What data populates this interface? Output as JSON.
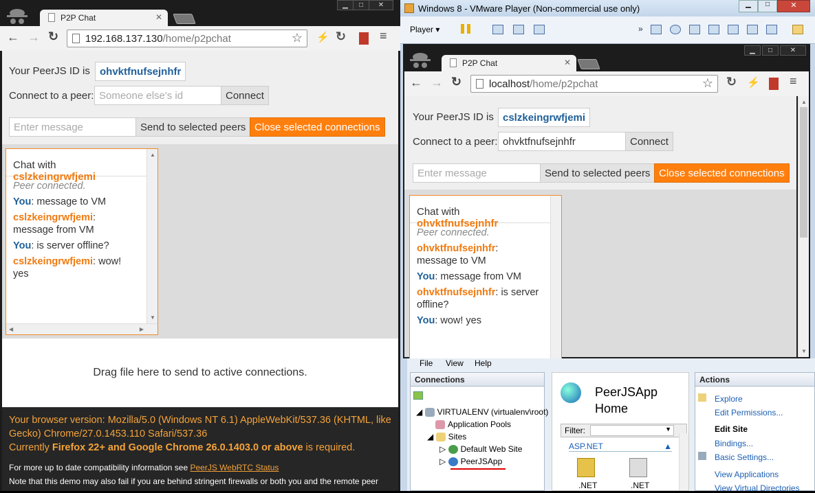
{
  "left_browser": {
    "tab_title": "P2P Chat",
    "url_host": "192.168.137.130",
    "url_path": "/home/p2pchat",
    "peer_id_label": "Your PeerJS ID is",
    "peer_id": "ohvktfnufsejnhfr",
    "connect_label": "Connect to a peer:",
    "connect_placeholder": "Someone else's id",
    "connect_button": "Connect",
    "message_placeholder": "Enter message",
    "send_button": "Send to selected peers",
    "close_button": "Close selected connections",
    "chat": {
      "with_label": "Chat with",
      "peer": "cslzkeingrwfjemi",
      "status": "Peer connected.",
      "messages": [
        {
          "from": "You",
          "text": ": message to VM"
        },
        {
          "from": "cslzkeingrwfjemi",
          "text": ":"
        },
        {
          "from": "",
          "text": "message from VM"
        },
        {
          "from": "You",
          "text": ": is server offline?"
        },
        {
          "from": "cslzkeingrwfjemi",
          "text": ": wow!"
        },
        {
          "from": "",
          "text": "yes"
        }
      ]
    },
    "drop_text": "Drag file here to send to active connections.",
    "footer": {
      "version_line": "Your browser version: Mozilla/5.0 (Windows NT 6.1) AppleWebKit/537.36 (KHTML, like Gecko) Chrome/27.0.1453.110 Safari/537.36",
      "req_prefix": "Currently",
      "req_bold": "Firefox 22+ and Google Chrome 26.0.1403.0 or above",
      "req_suffix": "is required.",
      "compat_prefix": "For more up to date compatibility information see",
      "compat_link": "PeerJS WebRTC Status",
      "note": "Note that this demo may also fail if you are behind stringent firewalls or both you and the remote peer"
    }
  },
  "vmware": {
    "title": "Windows 8 - VMware Player (Non-commercial use only)",
    "player_menu": "Player",
    "browser": {
      "tab_title": "P2P Chat",
      "url_host": "localhost",
      "url_path": "/home/p2pchat",
      "peer_id_label": "Your PeerJS ID is",
      "peer_id": "cslzkeingrwfjemi",
      "connect_label": "Connect to a peer:",
      "connect_value": "ohvktfnufsejnhfr",
      "connect_button": "Connect",
      "message_placeholder": "Enter message",
      "send_button": "Send to selected peers",
      "close_button": "Close selected connections",
      "chat": {
        "with_label": "Chat with",
        "peer": "ohvktfnufsejnhfr",
        "status": "Peer connected.",
        "m1_from": "ohvktfnufsejnhfr",
        "m1_text": "message to VM",
        "m2_from": "You",
        "m2_text": ": message from VM",
        "m3_from": "ohvktfnufsejnhfr",
        "m3_text": ": is server offline?",
        "m4_from": "You",
        "m4_text": ": wow! yes"
      }
    },
    "iis": {
      "menu": [
        "File",
        "View",
        "Help"
      ],
      "connections_title": "Connections",
      "tree": {
        "root": "VIRTUALENV (virtualenv\\root)",
        "app_pools": "Application Pools",
        "sites": "Sites",
        "default_site": "Default Web Site",
        "peerjs_app": "PeerJSApp"
      },
      "home_title": "PeerJSApp Home",
      "filter_label": "Filter:",
      "group": "ASP.NET",
      "icon1": ".NET",
      "icon2": ".NET",
      "actions_title": "Actions",
      "actions": {
        "explore": "Explore",
        "edit_permissions": "Edit Permissions...",
        "edit_site": "Edit Site",
        "bindings": "Bindings...",
        "basic_settings": "Basic Settings...",
        "view_apps": "View Applications",
        "view_vdirs": "View Virtual Directories"
      }
    }
  }
}
